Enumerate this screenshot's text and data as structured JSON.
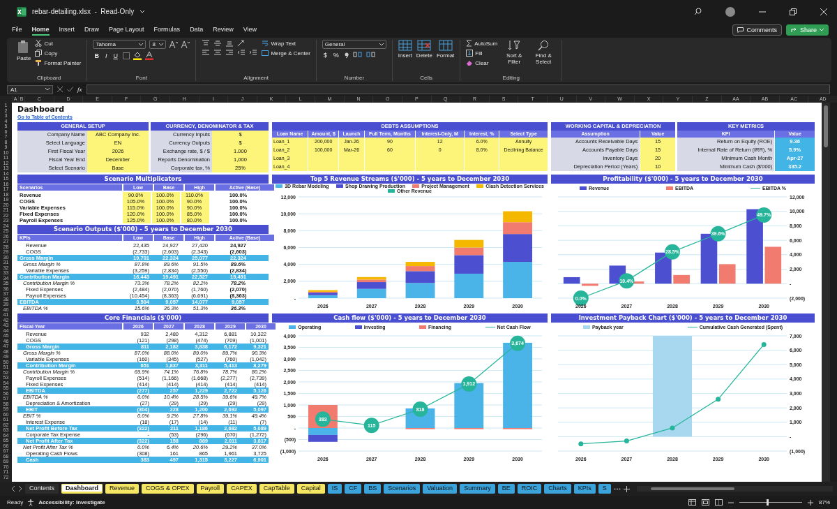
{
  "window": {
    "title": "rebar-detailing.xlsx  -  Read-Only"
  },
  "menu_tabs": [
    {
      "label": "File",
      "selected": false
    },
    {
      "label": "Home",
      "selected": true
    },
    {
      "label": "Insert",
      "selected": false
    },
    {
      "label": "Draw",
      "selected": false
    },
    {
      "label": "Page Layout",
      "selected": false
    },
    {
      "label": "Formulas",
      "selected": false
    },
    {
      "label": "Data",
      "selected": false
    },
    {
      "label": "Review",
      "selected": false
    },
    {
      "label": "View",
      "selected": false
    }
  ],
  "comments_button": "Comments",
  "share_button": "Share",
  "ribbon": {
    "clipboard": {
      "label": "Clipboard",
      "paste": "Paste",
      "cut": "Cut",
      "copy": "Copy",
      "format_painter": "Format Painter"
    },
    "font": {
      "label": "Font",
      "family": "Tahoma",
      "size": "8",
      "bold": "B",
      "italic": "I",
      "underline": "U"
    },
    "alignment": {
      "label": "Alignment",
      "wrap_text": "Wrap Text",
      "merge_center": "Merge & Center"
    },
    "number": {
      "label": "Number",
      "format": "General",
      "currency": "$",
      "percent": "%"
    },
    "cells": {
      "label": "Cells",
      "insert": "Insert",
      "delete": "Delete",
      "format": "Format"
    },
    "editing": {
      "label": "Editing",
      "autosum": "AutoSum",
      "fill": "Fill",
      "clear": "Clear",
      "sort_filter": "Sort & Filter",
      "find_select": "Find & Select"
    }
  },
  "formula_bar": {
    "name_box": "A1",
    "fx": "fx"
  },
  "column_letters": [
    "A",
    "B",
    "C",
    "D",
    "E",
    "F",
    "G",
    "H",
    "I",
    "J",
    "K",
    "L",
    "M",
    "N",
    "O",
    "P",
    "Q",
    "R",
    "S",
    "T",
    "U",
    "V",
    "W",
    "X",
    "Y",
    "Z",
    "AA",
    "AB",
    "AC",
    "AD"
  ],
  "row_numbers": [
    "1",
    "2",
    "3",
    "4",
    "5",
    "6",
    "7",
    "8",
    "9",
    "10",
    "11",
    "12",
    "13",
    "14",
    "15",
    "16",
    "17",
    "18",
    "19",
    "20",
    "21",
    "22",
    "23",
    "24",
    "25",
    "26",
    "27",
    "28",
    "29",
    "30",
    "31",
    "32",
    "33",
    "34",
    "35",
    "36",
    "37",
    "38",
    "39",
    "40",
    "41",
    "42",
    "43",
    "44",
    "45",
    "46",
    "47",
    "48",
    "49",
    "50",
    "51",
    "52",
    "53",
    "54",
    "55",
    "56",
    "57",
    "58",
    "59",
    "60",
    "61",
    "62",
    "63",
    "64",
    "65",
    "66",
    "67",
    "68",
    "69",
    "70",
    "71",
    "72"
  ],
  "sheet_title": "Dashboard",
  "toc_link": "Go to Table of Contents",
  "general_setup": {
    "title": "GENERAL SETUP",
    "rows": [
      {
        "label": "Company Name",
        "value": "ABC Company Inc."
      },
      {
        "label": "Select Language",
        "value": "EN"
      },
      {
        "label": "First Fiscal Year",
        "value": "2026"
      },
      {
        "label": "Fiscal Year End",
        "value": "December"
      },
      {
        "label": "Select Scenario",
        "value": "Base"
      }
    ]
  },
  "currency": {
    "title": "CURRENCY, DENOMINATOR & TAX",
    "rows": [
      {
        "label": "Currency Inputs",
        "value": "$"
      },
      {
        "label": "Currency Outputs",
        "value": "$"
      },
      {
        "label": "Exchange rate, $ / $",
        "value": "1.000"
      },
      {
        "label": "Reports Denomination",
        "value": "1,000"
      },
      {
        "label": "Corporate tax, %",
        "value": "25%"
      }
    ]
  },
  "debts": {
    "title": "DEBTS ASSUMPTIONS",
    "columns": [
      "Loan Name",
      "Amount, $",
      "Launch",
      "Full Term, Months",
      "Interest-Only, M",
      "Interest, %",
      "Select Type"
    ],
    "rows": [
      [
        "Loan_1",
        "200,000",
        "Jan-26",
        "90",
        "12",
        "6.0%",
        "Annuity"
      ],
      [
        "Loan_2",
        "100,000",
        "Mar-26",
        "60",
        "0",
        "8.0%",
        "Declining Balance"
      ],
      [
        "Loan_3"
      ],
      [
        "Loan_4"
      ]
    ]
  },
  "working_capital": {
    "title": "WORKING CAPITAL & DEPRECIATION",
    "columns": [
      "Assumption",
      "Value"
    ],
    "rows": [
      [
        "Accounts Receivable Days",
        "15"
      ],
      [
        "Accounts Payable Days",
        "15"
      ],
      [
        "Inventory Days",
        "20"
      ],
      [
        "Depreciation Period (Years)",
        "10"
      ]
    ]
  },
  "key_metrics": {
    "title": "KEY METRICS",
    "columns": [
      "KPI",
      "Value"
    ],
    "rows": [
      [
        "Return on Equity (ROE)",
        "9.36"
      ],
      [
        "Internal Rate of Return (IRR), %",
        "5.9%"
      ],
      [
        "Minimum Cash Month",
        "Apr-27"
      ],
      [
        "Minimum Cash ($'000)",
        "335.2"
      ]
    ]
  },
  "scenario_multiplicators": {
    "title": "Scenario Multiplicators",
    "columns": [
      "Scenarios",
      "Low",
      "Base",
      "High",
      "Active (Base)"
    ],
    "rows": [
      {
        "label": "Revenue",
        "values": [
          "90.0%",
          "100.0%",
          "110.0%",
          "100.0%"
        ]
      },
      {
        "label": "COGS",
        "values": [
          "105.0%",
          "100.0%",
          "90.0%",
          "100.0%"
        ]
      },
      {
        "label": "Variable Expenses",
        "values": [
          "115.0%",
          "100.0%",
          "90.0%",
          "100.0%"
        ]
      },
      {
        "label": "Fixed Expenses",
        "values": [
          "120.0%",
          "100.0%",
          "85.0%",
          "100.0%"
        ]
      },
      {
        "label": "Payroll Expenses",
        "values": [
          "125.0%",
          "100.0%",
          "80.0%",
          "100.0%"
        ]
      }
    ]
  },
  "scenario_outputs": {
    "title": "Scenario Outputs ($'000) - 5 years to December 2030",
    "columns": [
      "KPIs",
      "Low",
      "Base",
      "High",
      "Active (Base)"
    ],
    "rows": [
      {
        "kind": "value",
        "label": "Revenue",
        "values": [
          "22,435",
          "24,927",
          "27,420",
          "24,927"
        ]
      },
      {
        "kind": "value",
        "label": "COGS",
        "values": [
          "(2,733)",
          "(2,603)",
          "(2,343)",
          "(2,603)"
        ]
      },
      {
        "kind": "subtotal",
        "label": "Gross Margin",
        "values": [
          "19,701",
          "22,324",
          "25,077",
          "22,324"
        ]
      },
      {
        "kind": "percent",
        "label": "Gross Margin %",
        "values": [
          "87.8%",
          "89.6%",
          "91.5%",
          "89.6%"
        ]
      },
      {
        "kind": "value",
        "label": "Variable Expenses",
        "values": [
          "(3,259)",
          "(2,834)",
          "(2,550)",
          "(2,834)"
        ]
      },
      {
        "kind": "subtotal",
        "label": "Contribution Margin",
        "values": [
          "16,443",
          "19,491",
          "22,527",
          "19,491"
        ]
      },
      {
        "kind": "percent",
        "label": "Contribution Margin %",
        "values": [
          "73.3%",
          "78.2%",
          "82.2%",
          "78.2%"
        ]
      },
      {
        "kind": "value",
        "label": "Fixed Expenses",
        "values": [
          "(2,484)",
          "(2,070)",
          "(1,760)",
          "(2,070)"
        ]
      },
      {
        "kind": "value",
        "label": "Payroll Expenses",
        "values": [
          "(10,454)",
          "(8,363)",
          "(6,691)",
          "(8,363)"
        ]
      },
      {
        "kind": "subtotal",
        "label": "EBITDA",
        "values": [
          "3,504",
          "9,057",
          "14,077",
          "9,057"
        ]
      },
      {
        "kind": "percent",
        "label": "EBITDA %",
        "values": [
          "15.6%",
          "36.3%",
          "51.3%",
          "36.3%"
        ]
      }
    ]
  },
  "core_financials": {
    "title": "Core Financials ($'000)",
    "columns": [
      "Fiscal Year",
      "2026",
      "2027",
      "2028",
      "2029",
      "2030"
    ],
    "rows": [
      {
        "kind": "value",
        "label": "Revenue",
        "values": [
          "932",
          "2,480",
          "4,312",
          "6,881",
          "10,322"
        ]
      },
      {
        "kind": "value",
        "label": "COGS",
        "values": [
          "(121)",
          "(298)",
          "(474)",
          "(709)",
          "(1,001)"
        ]
      },
      {
        "kind": "subtotal",
        "label": "Gross Margin",
        "values": [
          "811",
          "2,182",
          "3,838",
          "6,172",
          "9,321"
        ]
      },
      {
        "kind": "percent",
        "label": "Gross Margin %",
        "values": [
          "87.0%",
          "88.0%",
          "89.0%",
          "89.7%",
          "90.3%"
        ]
      },
      {
        "kind": "value",
        "label": "Variable Expenses",
        "values": [
          "(160)",
          "(345)",
          "(527)",
          "(760)",
          "(1,042)"
        ]
      },
      {
        "kind": "subtotal",
        "label": "Contribution Margin",
        "values": [
          "651",
          "1,837",
          "3,311",
          "5,413",
          "8,279"
        ]
      },
      {
        "kind": "percent",
        "label": "Contribution Margin %",
        "values": [
          "69.9%",
          "74.1%",
          "76.8%",
          "78.7%",
          "80.2%"
        ]
      },
      {
        "kind": "value",
        "label": "Payroll Expenses",
        "values": [
          "(514)",
          "(1,166)",
          "(1,668)",
          "(2,277)",
          "(2,739)"
        ]
      },
      {
        "kind": "value",
        "label": "Fixed Expenses",
        "values": [
          "(414)",
          "(414)",
          "(414)",
          "(414)",
          "(414)"
        ]
      },
      {
        "kind": "subtotal",
        "label": "EBITDA",
        "values": [
          "(277)",
          "257",
          "1,229",
          "2,722",
          "5,126"
        ]
      },
      {
        "kind": "percent",
        "label": "EBITDA %",
        "values": [
          "0.0%",
          "10.4%",
          "28.5%",
          "39.6%",
          "49.7%"
        ]
      },
      {
        "kind": "value",
        "label": "Depreciation & Amortization",
        "values": [
          "(27)",
          "(29)",
          "(29)",
          "(29)",
          "(29)"
        ]
      },
      {
        "kind": "subtotal",
        "label": "EBIT",
        "values": [
          "(304)",
          "228",
          "1,200",
          "2,692",
          "5,097"
        ]
      },
      {
        "kind": "percent",
        "label": "EBIT %",
        "values": [
          "0.0%",
          "9.2%",
          "27.8%",
          "39.1%",
          "49.4%"
        ]
      },
      {
        "kind": "value",
        "label": "Interest Expense",
        "values": [
          "(18)",
          "(17)",
          "(14)",
          "(11)",
          "(7)"
        ]
      },
      {
        "kind": "subtotal",
        "label": "Net Profit Before Tax",
        "values": [
          "(322)",
          "211",
          "1,186",
          "2,682",
          "5,089"
        ]
      },
      {
        "kind": "value",
        "label": "Corporate Tax Expense",
        "values": [
          "-",
          "(53)",
          "(296)",
          "(670)",
          "(1,272)"
        ]
      },
      {
        "kind": "subtotal",
        "label": "Net Profit After Tax",
        "values": [
          "(322)",
          "158",
          "889",
          "2,011",
          "3,817"
        ]
      },
      {
        "kind": "percent",
        "label": "Net Profit After Tax %",
        "values": [
          "0.0%",
          "6.4%",
          "20.6%",
          "29.2%",
          "37.0%"
        ]
      },
      {
        "kind": "value",
        "label": "Operating Cash Flows",
        "values": [
          "(308)",
          "161",
          "865",
          "1,961",
          "3,725"
        ]
      },
      {
        "kind": "subtotal",
        "label": "Cash",
        "values": [
          "383",
          "497",
          "1,315",
          "3,227",
          "6,901"
        ]
      }
    ]
  },
  "charts": [
    {
      "chart_data": {
        "type": "bar",
        "title": "Top 5 Revenue Streams ($'000) - 5 years to December 2030",
        "legend": "top",
        "grid": true,
        "categories": [
          "2026",
          "2027",
          "2028",
          "2029",
          "2030"
        ],
        "stacked": true,
        "ylim": [
          0,
          12000
        ],
        "yticks": [
          {
            "value": 0,
            "label": "-"
          },
          {
            "value": 2000,
            "label": "2,000"
          },
          {
            "value": 4000,
            "label": "4,000"
          },
          {
            "value": 6000,
            "label": "6,000"
          },
          {
            "value": 8000,
            "label": "8,000"
          },
          {
            "value": 10000,
            "label": "10,000"
          },
          {
            "value": 12000,
            "label": "12,000"
          }
        ],
        "series": [
          {
            "name": "3D Rebar Modeling",
            "type": "bar",
            "color": "#4ab3e8",
            "values": [
              350,
              1100,
              1800,
              2900,
              4300
            ]
          },
          {
            "name": "Shop Drawing Production",
            "type": "bar",
            "color": "#4b4fd0",
            "values": [
              300,
              800,
              1400,
              2200,
              3300
            ]
          },
          {
            "name": "Project Management",
            "type": "bar",
            "color": "#f07b6e",
            "values": [
              100,
              300,
              600,
              900,
              1400
            ]
          },
          {
            "name": "Clash Detection Services",
            "type": "bar",
            "color": "#f5b800",
            "values": [
              200,
              300,
              500,
              900,
              1300
            ]
          },
          {
            "name": "Other Revenue",
            "type": "bar",
            "color": "#26b59a",
            "values": [
              0,
              0,
              0,
              0,
              0
            ]
          }
        ]
      }
    },
    {
      "chart_data": {
        "type": "bar",
        "title": "Profitability ($'000) - 5 years to December 2030",
        "legend": "top",
        "grid": true,
        "categories": [
          "2026",
          "2027",
          "2028",
          "2029",
          "2030"
        ],
        "stacked": false,
        "ylim": [
          -2000,
          12000
        ],
        "yticks": [
          {
            "value": -2000,
            "label": "(2,000)"
          },
          {
            "value": 0,
            "label": "-"
          },
          {
            "value": 2000,
            "label": "2,000"
          },
          {
            "value": 4000,
            "label": "4,000"
          },
          {
            "value": 6000,
            "label": "6,000"
          },
          {
            "value": 8000,
            "label": "8,000"
          },
          {
            "value": 10000,
            "label": "10,000"
          },
          {
            "value": 12000,
            "label": "12,000"
          }
        ],
        "series": [
          {
            "name": "Revenue",
            "type": "bar",
            "color": "#4b4fd0",
            "values": [
              900,
              2500,
              4300,
              6900,
              10300
            ]
          },
          {
            "name": "EBITDA",
            "type": "bar",
            "color": "#f07b6e",
            "values": [
              -300,
              300,
              1200,
              2700,
              5100
            ]
          },
          {
            "name": "EBITDA %",
            "type": "line",
            "marker": "circle",
            "color": "#26b59a",
            "values": [
              -2000,
              400,
              4400,
              6900,
              9500
            ]
          }
        ],
        "annotations": [
          {
            "x": "2026",
            "y": -2000,
            "text": "0.0%"
          },
          {
            "x": "2027",
            "y": 400,
            "text": "10.4%"
          },
          {
            "x": "2028",
            "y": 4400,
            "text": "28.5%"
          },
          {
            "x": "2029",
            "y": 6900,
            "text": "39.6%"
          },
          {
            "x": "2030",
            "y": 9500,
            "text": "49.7%"
          }
        ]
      }
    },
    {
      "chart_data": {
        "type": "bar",
        "title": "Cash flow ($'000) - 5 years to December 2030",
        "legend": "top",
        "grid": true,
        "categories": [
          "2026",
          "2027",
          "2028",
          "2029",
          "2030"
        ],
        "stacked": true,
        "ylim": [
          -1000,
          4000
        ],
        "yticks": [
          {
            "value": -1000,
            "label": "(1,000)"
          },
          {
            "value": -500,
            "label": "(500)"
          },
          {
            "value": 0,
            "label": "-"
          },
          {
            "value": 500,
            "label": "500"
          },
          {
            "value": 1000,
            "label": "1,000"
          },
          {
            "value": 1500,
            "label": "1,500"
          },
          {
            "value": 2000,
            "label": "2,000"
          },
          {
            "value": 2500,
            "label": "2,500"
          },
          {
            "value": 3000,
            "label": "3,000"
          },
          {
            "value": 3500,
            "label": "3,500"
          },
          {
            "value": 4000,
            "label": "4,000"
          }
        ],
        "series": [
          {
            "name": "Operating",
            "type": "bar",
            "color": "#4ab3e8",
            "values": [
              -300,
              null,
              850,
              1950,
              3700
            ]
          },
          {
            "name": "Investing",
            "type": "bar",
            "color": "#4b4fd0",
            "values": [
              -300,
              0,
              0,
              0,
              0
            ]
          },
          {
            "name": "Financing",
            "type": "bar",
            "color": "#f07b6e",
            "values": [
              1000,
              null,
              -50,
              -50,
              -50
            ]
          },
          {
            "name": "Net Cash Flow",
            "type": "line",
            "marker": "circle",
            "color": "#26b59a",
            "values": [
              383,
              115,
              818,
              1912,
              3674
            ],
            "value_labels": [
              "383",
              "115",
              "818",
              "1,912",
              "3,674"
            ]
          }
        ]
      }
    },
    {
      "chart_data": {
        "type": "bar",
        "title": "Investment Payback Chart ($'000) - 5 years to December 2030",
        "legend": "top",
        "grid": true,
        "categories": [
          "2026",
          "2027",
          "2028",
          "2029",
          "2030"
        ],
        "stacked": false,
        "ylim": [
          -1000,
          7000
        ],
        "yticks": [
          {
            "value": -1000,
            "label": "(1,000)"
          },
          {
            "value": 0,
            "label": "-"
          },
          {
            "value": 1000,
            "label": "1,000"
          },
          {
            "value": 2000,
            "label": "2,000"
          },
          {
            "value": 3000,
            "label": "3,000"
          },
          {
            "value": 4000,
            "label": "4,000"
          },
          {
            "value": 5000,
            "label": "5,000"
          },
          {
            "value": 6000,
            "label": "6,000"
          },
          {
            "value": 7000,
            "label": "7,000"
          }
        ],
        "series": [
          {
            "name": "Payback year",
            "type": "bar",
            "color": "#a8d8f0",
            "values": [
              null,
              null,
              7000,
              null,
              null
            ]
          },
          {
            "name": "Cumulative Cash Generated (Spent)",
            "type": "line",
            "marker": "circle",
            "color": "#26b59a",
            "values": [
              -500,
              -300,
              600,
              2600,
              6400
            ]
          }
        ]
      }
    }
  ],
  "sheet_tabs": [
    {
      "label": "Contents",
      "color": "#2b2b2b",
      "selected": false
    },
    {
      "label": "Dashboard",
      "color": "#f5e663",
      "selected": true
    },
    {
      "label": "Revenue",
      "color": "#f5e663",
      "selected": false
    },
    {
      "label": "COGS & OPEX",
      "color": "#f5e663",
      "selected": false
    },
    {
      "label": "Payroll",
      "color": "#f5e663",
      "selected": false
    },
    {
      "label": "CAPEX",
      "color": "#f5e663",
      "selected": false
    },
    {
      "label": "CapTable",
      "color": "#f5e663",
      "selected": false
    },
    {
      "label": "Capital",
      "color": "#f5e663",
      "selected": false
    },
    {
      "label": "IS",
      "color": "#3aa3dc",
      "selected": false
    },
    {
      "label": "CF",
      "color": "#3aa3dc",
      "selected": false
    },
    {
      "label": "BS",
      "color": "#3aa3dc",
      "selected": false
    },
    {
      "label": "Scenarios",
      "color": "#3aa3dc",
      "selected": false
    },
    {
      "label": "Valuation",
      "color": "#3aa3dc",
      "selected": false
    },
    {
      "label": "Summary",
      "color": "#3aa3dc",
      "selected": false
    },
    {
      "label": "BE",
      "color": "#3aa3dc",
      "selected": false
    },
    {
      "label": "ROIC",
      "color": "#3aa3dc",
      "selected": false
    },
    {
      "label": "Charts",
      "color": "#3aa3dc",
      "selected": false
    },
    {
      "label": "KPIs",
      "color": "#3aa3dc",
      "selected": false
    },
    {
      "label": "S",
      "color": "#3aa3dc",
      "selected": false
    }
  ],
  "status_bar": {
    "ready": "Ready",
    "accessibility": "Accessibility: Investigate",
    "zoom": {
      "level": 0.45,
      "reading": "87%"
    }
  }
}
